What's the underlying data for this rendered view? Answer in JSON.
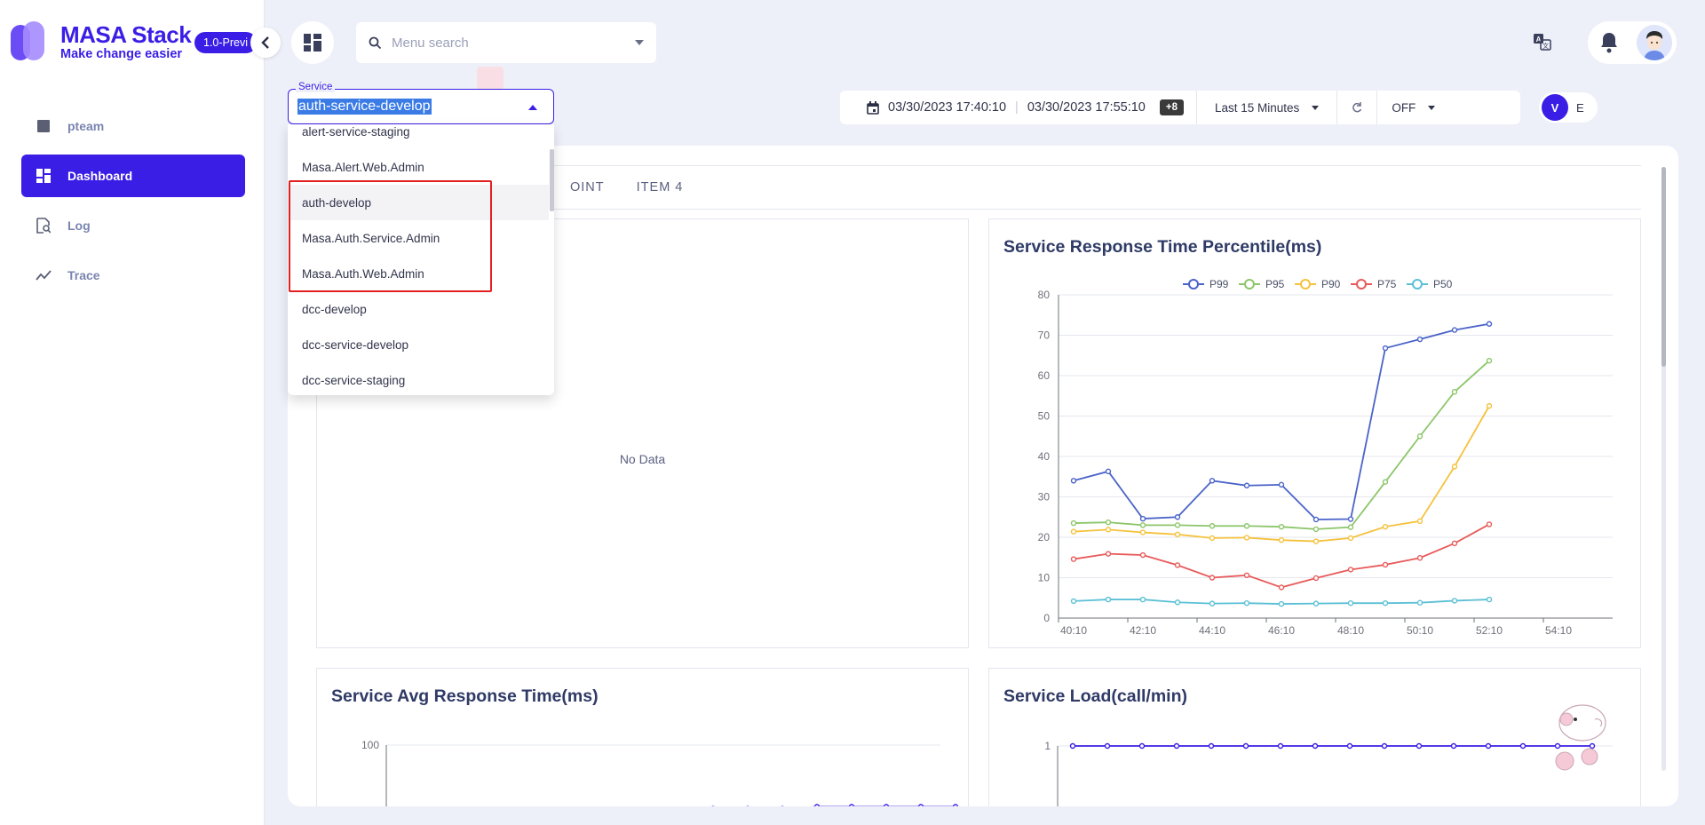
{
  "brand": {
    "title": "MASA Stack",
    "subtitle": "Make change easier",
    "version_badge": "1.0-Previ"
  },
  "sidebar": {
    "items": [
      {
        "label": "pteam",
        "icon": "team-icon",
        "active": false
      },
      {
        "label": "Dashboard",
        "icon": "dashboard-icon",
        "active": true
      },
      {
        "label": "Log",
        "icon": "log-icon",
        "active": false
      },
      {
        "label": "Trace",
        "icon": "trace-icon",
        "active": false
      }
    ]
  },
  "topbar": {
    "menu_search_placeholder": "Menu search"
  },
  "service_select": {
    "label": "Service",
    "value": "auth-service-develop",
    "options": [
      "alert-service-staging",
      "Masa.Alert.Web.Admin",
      "auth-develop",
      "Masa.Auth.Service.Admin",
      "Masa.Auth.Web.Admin",
      "dcc-develop",
      "dcc-service-develop",
      "dcc-service-staging"
    ]
  },
  "time_range": {
    "start": "03/30/2023 17:40:10",
    "end": "03/30/2023 17:55:10",
    "timezone": "+8",
    "preset": "Last 15 Minutes",
    "refresh": "OFF"
  },
  "view_toggle": {
    "v": "V",
    "e": "E"
  },
  "tabs": [
    "OINT",
    "ITEM 4"
  ],
  "panels": {
    "top_left": {
      "no_data": "No Data"
    },
    "percentile": {
      "title": "Service Response Time Percentile(ms)"
    },
    "avg": {
      "title": "Service Avg Response Time(ms)"
    },
    "load": {
      "title": "Service Load(call/min)"
    }
  },
  "chart_data": [
    {
      "type": "line",
      "title": "Service Response Time Percentile(ms)",
      "x": [
        "40:10",
        "41:10",
        "42:10",
        "43:10",
        "44:10",
        "45:10",
        "46:10",
        "47:10",
        "48:10",
        "49:10",
        "50:10",
        "51:10",
        "52:10"
      ],
      "xticks": [
        "40:10",
        "42:10",
        "44:10",
        "46:10",
        "48:10",
        "50:10",
        "52:10",
        "54:10"
      ],
      "ylim": [
        0,
        80
      ],
      "yticks": [
        0,
        10,
        20,
        30,
        40,
        50,
        60,
        70,
        80
      ],
      "legend": "top",
      "grid": true,
      "series": [
        {
          "name": "P99",
          "color": "#4a63c8",
          "values": [
            34,
            36.3,
            24.6,
            25,
            34,
            32.8,
            33,
            24.4,
            24.5,
            66.8,
            69,
            71.3,
            72.8
          ]
        },
        {
          "name": "P95",
          "color": "#8cc66a",
          "values": [
            23.5,
            23.7,
            23,
            23,
            22.8,
            22.8,
            22.6,
            22,
            22.5,
            33.7,
            45,
            56,
            63.7
          ]
        },
        {
          "name": "P90",
          "color": "#f5c23e",
          "values": [
            21.4,
            21.9,
            21.2,
            20.7,
            19.8,
            19.9,
            19.3,
            19,
            19.8,
            22.6,
            24,
            37.5,
            52.5
          ]
        },
        {
          "name": "P75",
          "color": "#e85a5a",
          "values": [
            14.6,
            15.9,
            15.6,
            13.1,
            10,
            10.6,
            7.6,
            9.9,
            12,
            13.2,
            14.9,
            18.5,
            23.2
          ]
        },
        {
          "name": "P50",
          "color": "#5bc0d5",
          "values": [
            4.2,
            4.6,
            4.6,
            3.9,
            3.6,
            3.7,
            3.5,
            3.6,
            3.7,
            3.7,
            3.8,
            4.3,
            4.6
          ]
        }
      ]
    },
    {
      "type": "line",
      "title": "Service Avg Response Time(ms)",
      "yticks": [
        100
      ],
      "ylim": [
        0,
        100
      ],
      "series": [
        {
          "color": "#3a1ee6",
          "values": [
            null,
            null,
            null,
            null,
            null,
            null,
            null,
            0,
            0,
            3,
            3,
            3,
            5,
            5,
            5,
            5,
            5
          ]
        }
      ]
    },
    {
      "type": "line",
      "title": "Service Load(call/min)",
      "yticks": [
        1
      ],
      "series": [
        {
          "color": "#3a1ee6",
          "values": [
            1,
            1,
            1,
            1,
            1,
            1,
            1,
            1,
            1,
            1,
            1,
            1,
            1,
            1,
            1,
            1
          ]
        }
      ]
    }
  ]
}
